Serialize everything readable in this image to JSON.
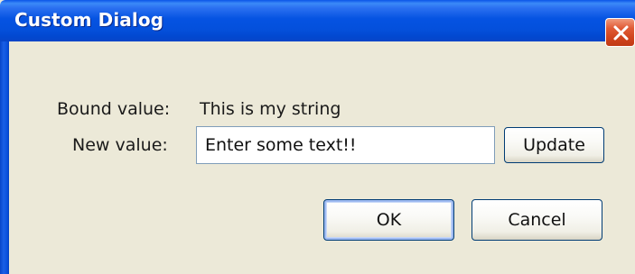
{
  "window": {
    "title": "Custom Dialog"
  },
  "title_bar": {
    "close_icon": "close-icon"
  },
  "form": {
    "bound_label": "Bound value:",
    "bound_value": "This is my string",
    "new_label": "New value:",
    "new_value": "Enter some text!!"
  },
  "buttons": {
    "update": "Update",
    "ok": "OK",
    "cancel": "Cancel"
  },
  "colors": {
    "titlebar": "#0553e2",
    "close_button": "#d0441c",
    "dialog_background": "#ece9d8",
    "button_border": "#003c74"
  }
}
